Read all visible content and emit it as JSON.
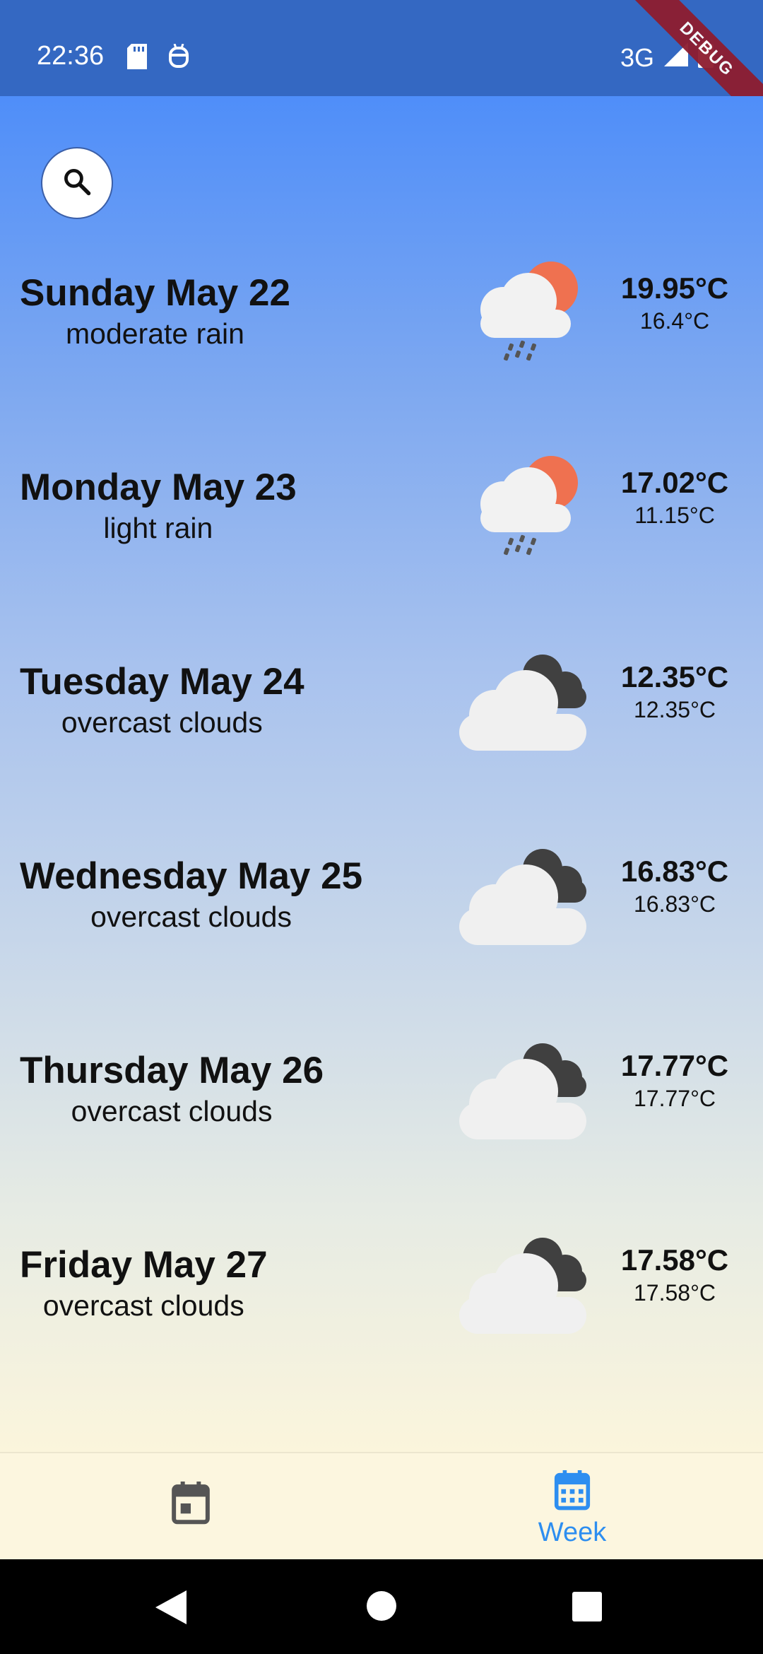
{
  "status_bar": {
    "time": "22:36",
    "network": "3G",
    "debug_label": "DEBUG"
  },
  "search": {
    "icon": "search-icon"
  },
  "days": [
    {
      "title": "Sunday May 22",
      "desc": "moderate rain",
      "max": "19.95°C",
      "min": "16.4°C",
      "icon": "sun-cloud-rain-icon"
    },
    {
      "title": "Monday May 23",
      "desc": "light rain",
      "max": "17.02°C",
      "min": "11.15°C",
      "icon": "sun-cloud-rain-icon"
    },
    {
      "title": "Tuesday May 24",
      "desc": "overcast clouds",
      "max": "12.35°C",
      "min": "12.35°C",
      "icon": "overcast-clouds-icon"
    },
    {
      "title": "Wednesday May 25",
      "desc": "overcast clouds",
      "max": "16.83°C",
      "min": "16.83°C",
      "icon": "overcast-clouds-icon"
    },
    {
      "title": "Thursday May 26",
      "desc": "overcast clouds",
      "max": "17.77°C",
      "min": "17.77°C",
      "icon": "overcast-clouds-icon"
    },
    {
      "title": "Friday May 27",
      "desc": "overcast clouds",
      "max": "17.58°C",
      "min": "17.58°C",
      "icon": "overcast-clouds-icon"
    }
  ],
  "bottom_nav": {
    "week_label": "Week"
  },
  "colors": {
    "accent": "#2d8ef0",
    "status_bar": "#3468c2",
    "sun": "#ef7150"
  }
}
